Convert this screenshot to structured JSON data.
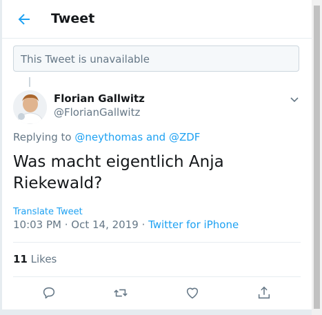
{
  "header": {
    "title": "Tweet",
    "back_icon": "arrow-left-icon"
  },
  "quoted": {
    "unavailable_text": "This Tweet is unavailable"
  },
  "author": {
    "display_name": "Florian Gallwitz",
    "handle": "@FlorianGallwitz",
    "avatar_icon": "user-avatar"
  },
  "reply": {
    "prefix": "Replying to",
    "user1": "@neythomas",
    "conj": "and",
    "user2": "@ZDF"
  },
  "tweet": {
    "text": "Was macht eigentlich Anja Riekewald?"
  },
  "translate_label": "Translate Tweet",
  "meta": {
    "time": "10:03 PM",
    "sep1": " · ",
    "date": "Oct 14, 2019",
    "sep2": " · ",
    "source": "Twitter for iPhone"
  },
  "stats": {
    "likes_count": "11",
    "likes_label": "Likes"
  },
  "actions": [
    "reply-icon",
    "retweet-icon",
    "like-icon",
    "share-icon"
  ],
  "colors": {
    "accent": "#1da1f2",
    "muted": "#657786",
    "text": "#14171a",
    "border": "#e6ecf0"
  }
}
